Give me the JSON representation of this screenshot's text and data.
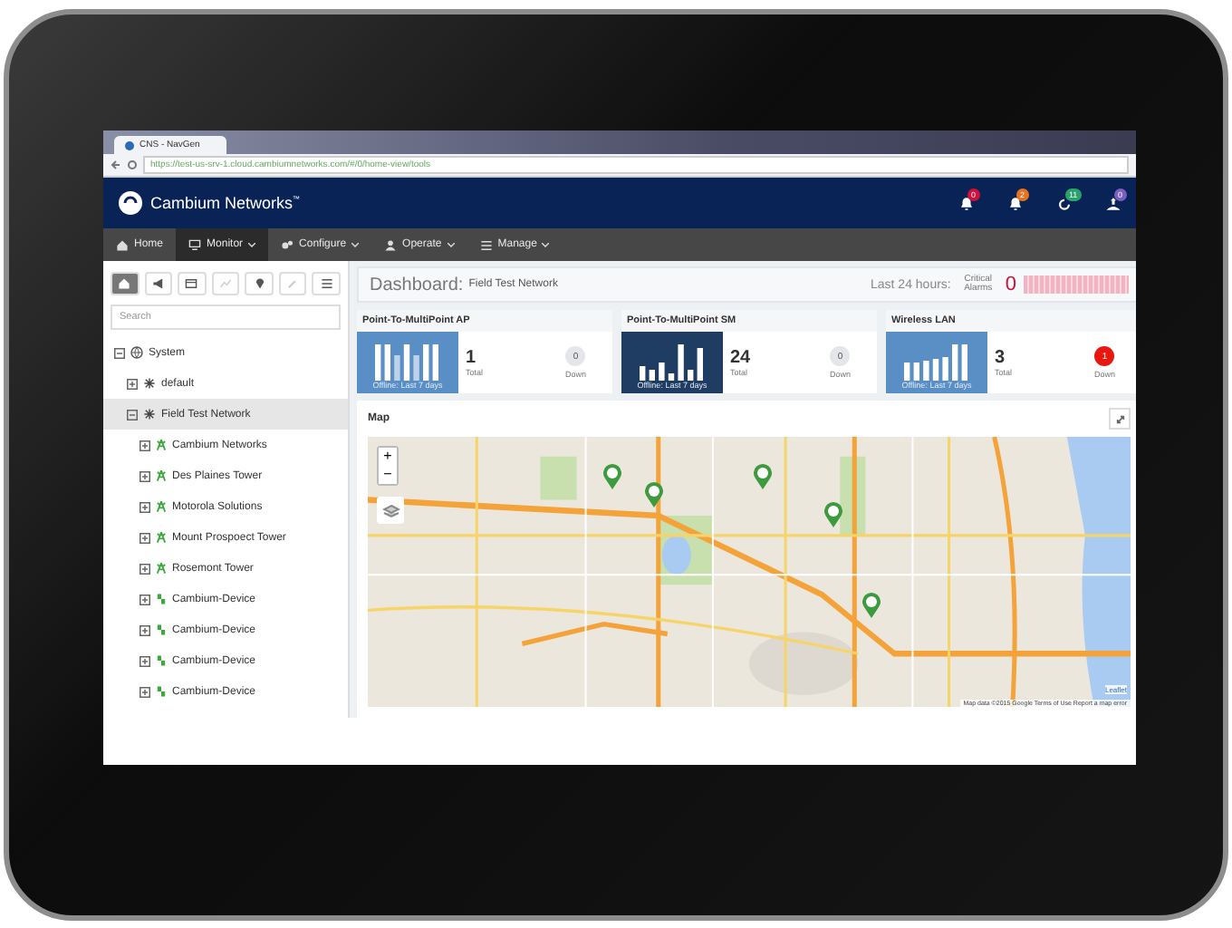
{
  "browser": {
    "tab_title": "CNS - NavGen",
    "url": "https://test-us-srv-1.cloud.cambiumnetworks.com/#/0/home-view/tools"
  },
  "header": {
    "brand": "Cambium Networks",
    "trademark": "™",
    "notifications": [
      {
        "kind": "bell",
        "count": "0",
        "color": "#d0103a"
      },
      {
        "kind": "bell",
        "count": "2",
        "color": "#e8731e"
      },
      {
        "kind": "check",
        "count": "11",
        "color": "#2aa36b"
      },
      {
        "kind": "user",
        "count": "0",
        "color": "#7b5fc0"
      }
    ]
  },
  "nav": [
    {
      "label": "Home",
      "kind": "home",
      "selected": false,
      "dropdown": false
    },
    {
      "label": "Monitor",
      "kind": "monitor",
      "selected": true,
      "dropdown": true
    },
    {
      "label": "Configure",
      "kind": "gears",
      "selected": false,
      "dropdown": true
    },
    {
      "label": "Operate",
      "kind": "user",
      "selected": false,
      "dropdown": true
    },
    {
      "label": "Manage",
      "kind": "list",
      "selected": false,
      "dropdown": true
    }
  ],
  "sidebar": {
    "tools": [
      {
        "kind": "home",
        "selected": true,
        "disabled": false
      },
      {
        "kind": "megaphone",
        "selected": false,
        "disabled": false
      },
      {
        "kind": "card",
        "selected": false,
        "disabled": false
      },
      {
        "kind": "chart",
        "selected": false,
        "disabled": true
      },
      {
        "kind": "pin",
        "selected": false,
        "disabled": false
      },
      {
        "kind": "wrench",
        "selected": false,
        "disabled": true
      },
      {
        "kind": "list",
        "selected": false,
        "disabled": false
      }
    ],
    "search": {
      "placeholder": "Search"
    },
    "tree": [
      {
        "label": "System",
        "kind": "system",
        "expanded": true,
        "selected": false,
        "children": [
          {
            "label": "default",
            "kind": "network",
            "expanded": false,
            "selected": false
          },
          {
            "label": "Field Test Network",
            "kind": "network",
            "expanded": true,
            "selected": true,
            "children": [
              {
                "label": "Cambium Networks",
                "kind": "tower",
                "expanded": false,
                "selected": false
              },
              {
                "label": "Des Plaines Tower",
                "kind": "tower",
                "expanded": false,
                "selected": false
              },
              {
                "label": "Motorola Solutions",
                "kind": "tower",
                "expanded": false,
                "selected": false
              },
              {
                "label": "Mount Prospoect Tower",
                "kind": "tower",
                "expanded": false,
                "selected": false
              },
              {
                "label": "Rosemont Tower",
                "kind": "tower",
                "expanded": false,
                "selected": false
              },
              {
                "label": "Cambium-Device",
                "kind": "device",
                "expanded": false,
                "selected": false
              },
              {
                "label": "Cambium-Device",
                "kind": "device",
                "expanded": false,
                "selected": false
              },
              {
                "label": "Cambium-Device",
                "kind": "device",
                "expanded": false,
                "selected": false
              },
              {
                "label": "Cambium-Device",
                "kind": "device",
                "expanded": false,
                "selected": false
              }
            ]
          }
        ]
      }
    ]
  },
  "dashboard": {
    "title": "Dashboard:",
    "subtitle": "Field Test Network",
    "period": "Last 24 hours:",
    "alarms_label": "Critical Alarms",
    "alarms_count": "0"
  },
  "cards": [
    {
      "title": "Point-To-MultiPoint AP",
      "caption": "Offline: Last 7 days",
      "dark": false,
      "total": "1",
      "total_label": "Total",
      "down": "0",
      "down_label": "Down",
      "alert": false
    },
    {
      "title": "Point-To-MultiPoint SM",
      "caption": "Offline: Last 7 days",
      "dark": true,
      "total": "24",
      "total_label": "Total",
      "down": "0",
      "down_label": "Down",
      "alert": false
    },
    {
      "title": "Wireless LAN",
      "caption": "Offline: Last 7 days",
      "dark": false,
      "total": "3",
      "total_label": "Total",
      "down": "1",
      "down_label": "Down",
      "alert": true
    }
  ],
  "map": {
    "title": "Map",
    "zoom_in": "+",
    "zoom_out": "−",
    "leaflet": "Leaflet",
    "attribution": "Map data ©2015 Google   Terms of Use   Report a map error"
  }
}
